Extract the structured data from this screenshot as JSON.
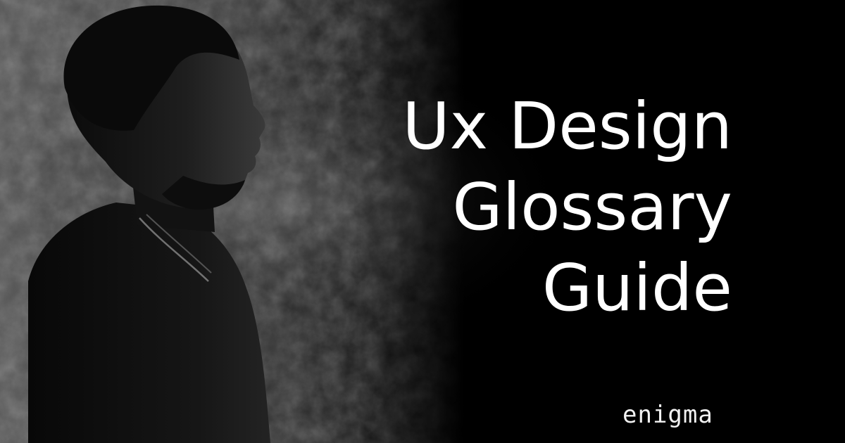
{
  "headline": {
    "line1": "Ux Design",
    "line2": "Glossary",
    "line3": "Guide"
  },
  "brand": {
    "logo_text": "enigma"
  },
  "photo": {
    "icon": "person-profile-portrait"
  },
  "colors": {
    "background": "#000000",
    "text": "#ffffff",
    "wall": "#4a4a4a"
  }
}
